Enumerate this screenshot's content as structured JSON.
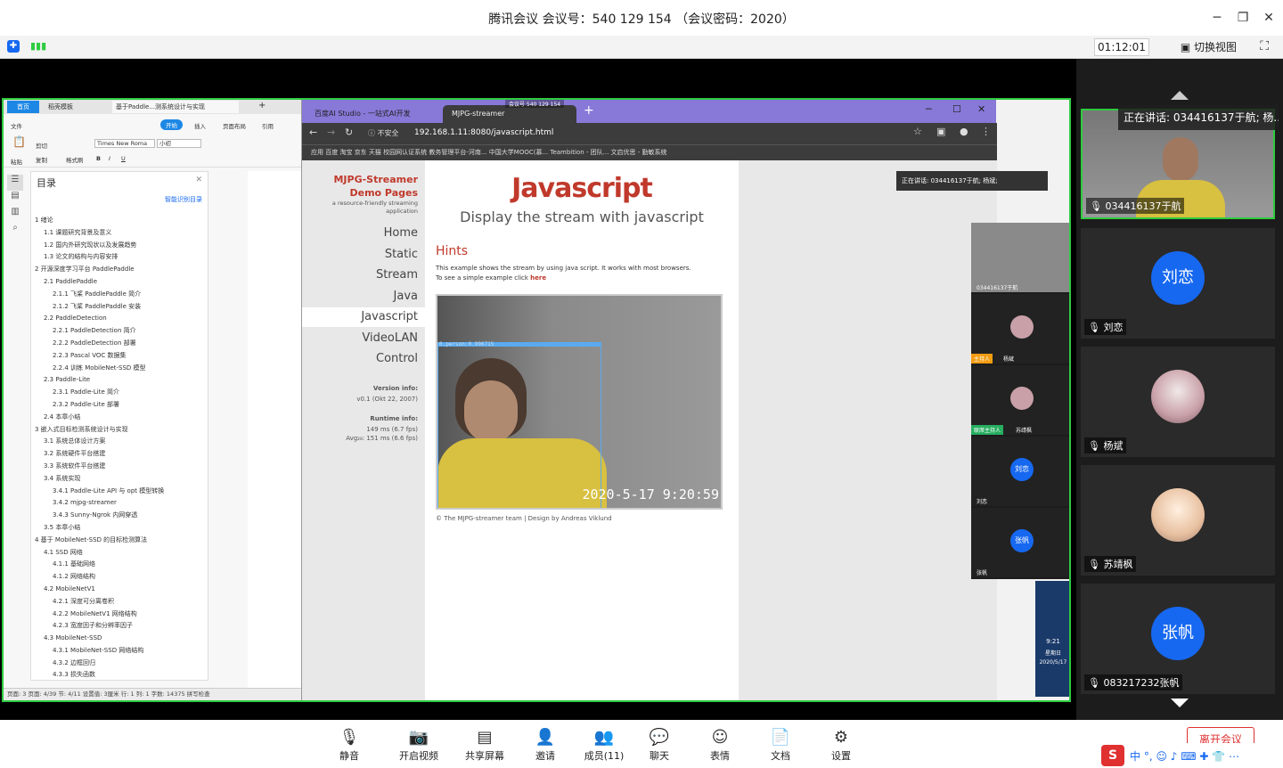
{
  "window": {
    "title": "腾讯会议 会议号：540 129 154 （会议密码：2020）",
    "timer": "01:12:01",
    "switch_view": "切换视图"
  },
  "doc": {
    "tabs": [
      "首页",
      "稻壳模板",
      "基于Paddle...测系统设计与实现",
      "+"
    ],
    "ribbon": {
      "file": "文件",
      "start": "开始",
      "insert": "插入",
      "layout": "页面布局",
      "reference": "引用",
      "font": "Times New Roma",
      "size": "小初",
      "paste": "粘贴",
      "format_painter": "格式刷",
      "cut": "剪切",
      "copy": "复制"
    },
    "toc_title": "目录",
    "smart_toc": "智能识别目录",
    "toc": [
      "1 绪论",
      "1.1 课题研究背景及意义",
      "1.2 国内外研究现状以及发展趋势",
      "1.3 论文的结构与内容安排",
      "2 开源深度学习平台 PaddlePaddle",
      "2.1 PaddlePaddle",
      "2.1.1 飞桨 PaddlePaddle 简介",
      "2.1.2 飞桨 PaddlePaddle 安装",
      "2.2 PaddleDetection",
      "2.2.1 PaddleDetection 简介",
      "2.2.2 PaddleDetection 部署",
      "2.2.3 Pascal VOC 数据集",
      "2.2.4 训练 MobileNet-SSD 模型",
      "2.3 Paddle-Lite",
      "2.3.1 Paddle-Lite 简介",
      "2.3.2 Paddle-Lite 部署",
      "2.4 本章小结",
      "3 嵌入式目标检测系统设计与实现",
      "3.1 系统总体设计方案",
      "3.2 系统硬件平台搭建",
      "3.3 系统软件平台搭建",
      "3.4 系统实现",
      "3.4.1 Paddle-Lite API 与 opt 模型转换",
      "3.4.2 mjpg-streamer",
      "3.4.3 Sunny-Ngrok 内网穿透",
      "3.5 本章小结",
      "4 基于 MobileNet-SSD 的目标检测算法",
      "4.1 SSD 网络",
      "4.1.1 基础网络",
      "4.1.2 网络结构",
      "4.2 MobileNetV1",
      "4.2.1 深度可分离卷积",
      "4.2.2 MobileNetV1 网络结构",
      "4.2.3 宽度因子和分辨率因子",
      "4.3 MobileNet-SSD",
      "4.3.1 MobileNet-SSD 网络结构",
      "4.3.2 边框回归",
      "4.3.3 损失函数"
    ],
    "toc_indent": [
      0,
      1,
      1,
      1,
      0,
      1,
      2,
      2,
      1,
      2,
      2,
      2,
      2,
      1,
      2,
      2,
      1,
      0,
      1,
      1,
      1,
      1,
      2,
      2,
      2,
      1,
      0,
      1,
      2,
      2,
      1,
      2,
      2,
      2,
      1,
      2,
      2,
      2
    ],
    "status": "页面: 3   页面: 4/39   节: 4/11   设置值: 3厘米   行: 1   列: 1   字数: 14375   拼写检查"
  },
  "browser": {
    "tab1": "百度AI Studio - 一站式AI开发",
    "tab2": "MJPG-streamer",
    "meeting_badge": "会议号 540 129 154",
    "insecure": "不安全",
    "url": "192.168.1.11:8080/javascript.html",
    "bookmarks": "应用   百度   淘宝   京东   天猫   校园网认证系统   教务管理平台-河南...   中国大学MOOC(慕...   Teambition - 团队...   文启优思 - 勤敏系统",
    "page": {
      "logo": "MJPG-Streamer Demo Pages",
      "logo_sub": "a resource-friendly streaming application",
      "menu": [
        "Home",
        "Static",
        "Stream",
        "Java",
        "Javascript",
        "VideoLAN",
        "Control"
      ],
      "version_label": "Version info:",
      "version": "v0.1 (Okt 22, 2007)",
      "runtime_label": "Runtime info:",
      "runtime1": "149 ms (6.7 fps)",
      "runtime2": "Avg₂₈: 151 ms (6.6 fps)",
      "heading": "Javascript",
      "subheading": "Display the stream with javascript",
      "hints": "Hints",
      "hint_text": "This example shows the stream by using java script. It works with most browsers.",
      "hint_text2": "To see a simple example click ",
      "here": "here",
      "detect_label": "0.person:0.996715",
      "timestamp": "2020-5-17 9:20:59",
      "footer": "© The MJPG-streamer team | Design by Andreas Viklund"
    }
  },
  "overlay": {
    "speaking": "正在讲话: 0344161​37于航; 杨斌;",
    "small_tiles": [
      {
        "name": "0344161​37于航"
      },
      {
        "name": "杨斌",
        "role": "主持人"
      },
      {
        "name": "苏靖枫",
        "role": "联席主持人"
      },
      {
        "name": "刘恋",
        "avatar": "刘恋"
      },
      {
        "name": "张帆",
        "avatar": "张帆"
      }
    ],
    "clock": "9:21",
    "weekday": "星期日",
    "date": "2020/5/17"
  },
  "participants": {
    "speaking": "正在讲话: 0344161​37于航; 杨...",
    "tiles": [
      {
        "name": "0344161​37于航",
        "avatar": ""
      },
      {
        "name": "刘恋",
        "avatar": "刘恋"
      },
      {
        "name": "杨斌",
        "avatar": ""
      },
      {
        "name": "苏靖枫",
        "avatar": ""
      },
      {
        "name": "0832172​32张帆",
        "avatar": "张帆"
      }
    ]
  },
  "toolbar": {
    "items": [
      "静音",
      "开启视频",
      "共享屏幕",
      "邀请",
      "成员(11)",
      "聊天",
      "表情",
      "文档",
      "设置"
    ],
    "leave": "离开会议"
  },
  "colors": {
    "share_border": "#2ecc40",
    "avatar_blue": "#1668f0",
    "logo_red": "#c0392b",
    "host_badge": "#f39c12",
    "cohost_badge": "#27ae60"
  }
}
